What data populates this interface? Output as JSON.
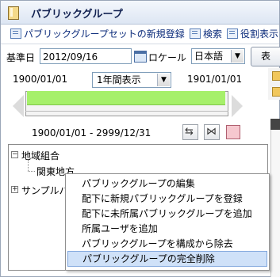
{
  "window": {
    "title": "パブリックグループ"
  },
  "toolbar": {
    "items": [
      {
        "label": "パブリックグループセットの新規登録",
        "icon": "document-add-icon"
      },
      {
        "label": "検索",
        "icon": "search-list-icon"
      },
      {
        "label": "役割表示",
        "icon": "role-list-icon"
      }
    ]
  },
  "filters": {
    "base_date_label": "基準日",
    "base_date_value": "2012/09/16",
    "locale_label": "ロケール",
    "locale_value": "日本語",
    "right_button_label": "表"
  },
  "timeline": {
    "start_label": "1900/01/01",
    "end_label": "1901/01/01",
    "range_select": "1年間表示",
    "period_label": "1900/01/01 - 2999/12/31"
  },
  "tree": {
    "nodes": [
      {
        "label": "地域組合",
        "expander": "−"
      },
      {
        "label": "関東地方"
      },
      {
        "label": "サンプルパ",
        "expander": "+"
      }
    ]
  },
  "context_menu": {
    "items": [
      "パブリックグループの編集",
      "配下に新規パブリックグループを登録",
      "配下に未所属パブリックグループを追加",
      "所属ユーザを追加",
      "パブリックグループを構成から除去",
      "パブリックグループの完全削除"
    ],
    "highlighted_index": 5
  },
  "colors": {
    "accent_blue": "#0a2a7a",
    "timeline_fill": "#a6f06a",
    "menu_highlight": "#cfe1f8"
  }
}
